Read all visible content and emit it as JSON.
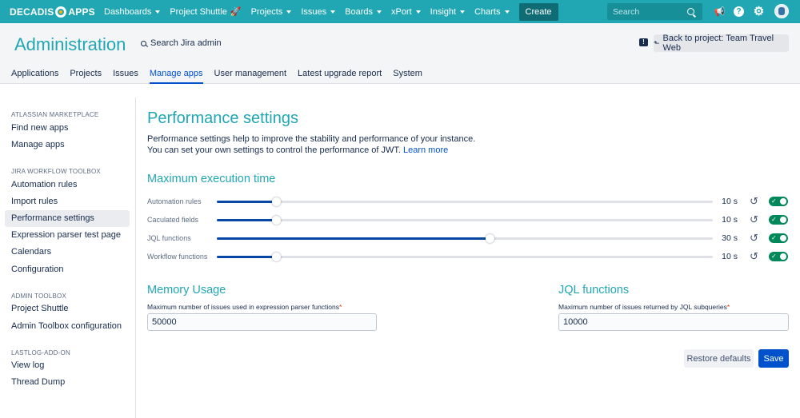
{
  "topnav": {
    "logo": {
      "left": "DECADIS",
      "right": "APPS"
    },
    "items": [
      {
        "label": "Dashboards"
      },
      {
        "label": "Project Shuttle"
      },
      {
        "label": "Projects"
      },
      {
        "label": "Issues"
      },
      {
        "label": "Boards"
      },
      {
        "label": "xPort"
      },
      {
        "label": "Insight"
      },
      {
        "label": "Charts"
      }
    ],
    "create_label": "Create",
    "search_placeholder": "Search",
    "accent_color": "#21a7b3"
  },
  "header": {
    "title": "Administration",
    "search_label": "Search Jira admin",
    "back_button": "Back to project: Team Travel Web",
    "tabs": [
      "Applications",
      "Projects",
      "Issues",
      "Manage apps",
      "User management",
      "Latest upgrade report",
      "System"
    ],
    "active_tab": "Manage apps"
  },
  "sidebar": {
    "groups": [
      {
        "title": "ATLASSIAN MARKETPLACE",
        "items": [
          "Find new apps",
          "Manage apps"
        ]
      },
      {
        "title": "JIRA WORKFLOW TOOLBOX",
        "items": [
          "Automation rules",
          "Import rules",
          "Performance settings",
          "Expression parser test page",
          "Calendars",
          "Configuration"
        ]
      },
      {
        "title": "ADMIN TOOLBOX",
        "items": [
          "Project Shuttle",
          "Admin Toolbox configuration"
        ]
      },
      {
        "title": "LASTLOG-ADD-ON",
        "items": [
          "View log",
          "Thread Dump"
        ]
      }
    ],
    "active_item": "Performance settings"
  },
  "main": {
    "title": "Performance settings",
    "desc_line1": "Performance settings help to improve the stability and performance of your instance.",
    "desc_line2": "You can set your own settings to control the performance of JWT.",
    "learn_more": "Learn more",
    "execution": {
      "title": "Maximum execution time",
      "rows": [
        {
          "label": "Automation rules",
          "value": "10 s",
          "fraction": 0.12,
          "enabled": true
        },
        {
          "label": "Caculated fields",
          "value": "10 s",
          "fraction": 0.12,
          "enabled": true
        },
        {
          "label": "JQL functions",
          "value": "30 s",
          "fraction": 0.55,
          "enabled": true
        },
        {
          "label": "Workflow functions",
          "value": "10 s",
          "fraction": 0.12,
          "enabled": true
        }
      ]
    },
    "memory": {
      "title": "Memory Usage",
      "label": "Maximum number of issues used in expression parser functions",
      "value": "50000"
    },
    "jql": {
      "title": "JQL functions",
      "label": "Maximum number of issues returned by JQL subqueries",
      "value": "10000"
    },
    "restore_label": "Restore defaults",
    "save_label": "Save"
  }
}
